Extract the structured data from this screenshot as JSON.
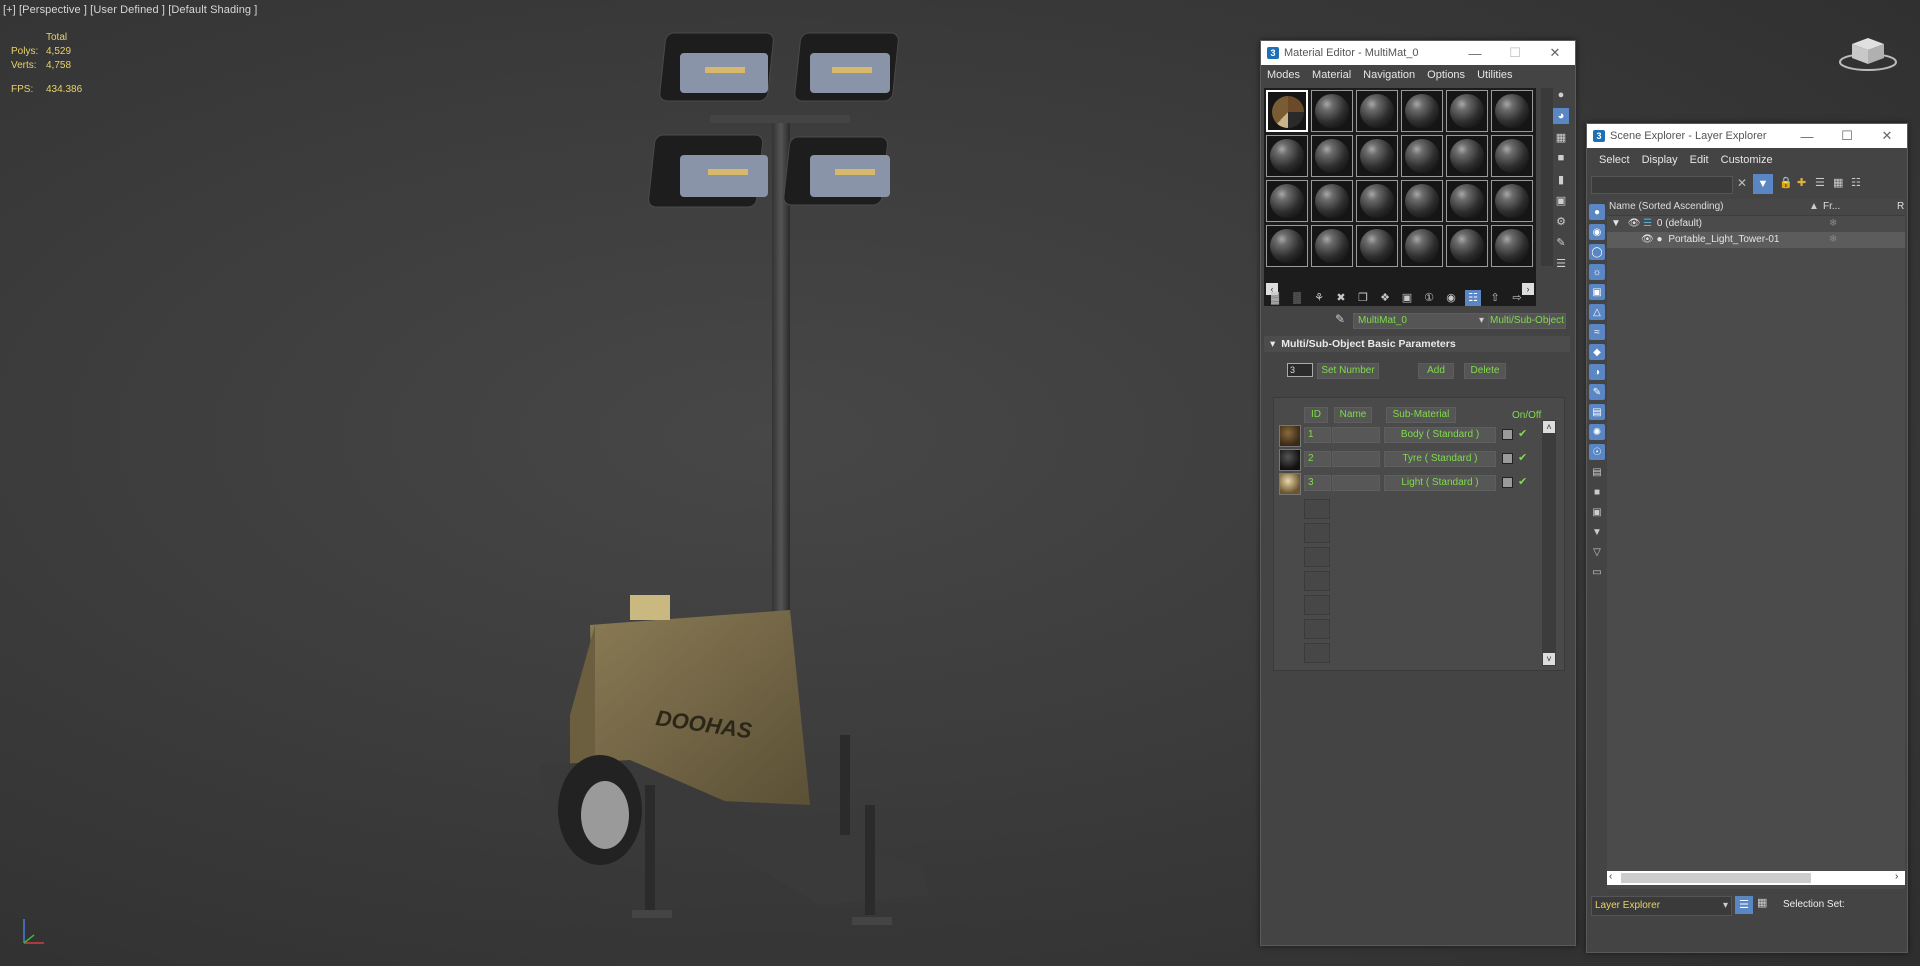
{
  "viewport": {
    "label": "[+] [Perspective ] [User Defined ] [Default Shading ]",
    "stats": {
      "total_label": "Total",
      "polys_label": "Polys:",
      "polys_value": "4,529",
      "verts_label": "Verts:",
      "verts_value": "4,758",
      "fps_label": "FPS:",
      "fps_value": "434.386"
    },
    "model_brand_text": "DOOHAS"
  },
  "material_editor": {
    "title": "Material Editor - MultiMat_0",
    "menu": [
      "Modes",
      "Material",
      "Navigation",
      "Options",
      "Utilities"
    ],
    "material_name": "MultiMat_0",
    "material_type": "Multi/Sub-Object",
    "rollout_title": "Multi/Sub-Object Basic Parameters",
    "set_number_value": "3",
    "set_number_label": "Set Number",
    "add_label": "Add",
    "delete_label": "Delete",
    "columns": {
      "id": "ID",
      "name": "Name",
      "sub_material": "Sub-Material",
      "on_off": "On/Off"
    },
    "rows": [
      {
        "id": "1",
        "name": "",
        "sub_material": "Body  ( Standard )"
      },
      {
        "id": "2",
        "name": "",
        "sub_material": "Tyre  ( Standard )"
      },
      {
        "id": "3",
        "name": "",
        "sub_material": "Light  ( Standard )"
      }
    ]
  },
  "scene_explorer": {
    "title": "Scene Explorer - Layer Explorer",
    "menu": [
      "Select",
      "Display",
      "Edit",
      "Customize"
    ],
    "column_name": "Name (Sorted Ascending)",
    "column_fr": "Fr...",
    "column_r": "R",
    "tree": {
      "layer": "0 (default)",
      "object": "Portable_Light_Tower-01"
    },
    "explorer_mode": "Layer Explorer",
    "selection_set_label": "Selection Set:"
  },
  "colors": {
    "accent_green": "#7fdc4a",
    "stats_yellow": "#e8d26a",
    "ui_panel": "#444444",
    "icon_blue": "#5a87c4"
  }
}
